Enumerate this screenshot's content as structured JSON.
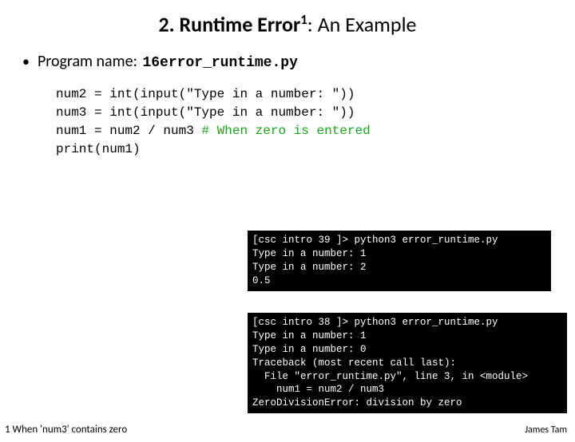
{
  "title": {
    "prefix_number": "2.",
    "bold_text": "Runtime Error",
    "sup": "1",
    "tail": ": An Example"
  },
  "bullet": {
    "label": "Program name:",
    "program": "16error_runtime.py"
  },
  "code": {
    "l1": "num2 = int(input(\"Type in a number: \"))",
    "l2": "num3 = int(input(\"Type in a number: \"))",
    "l3a": "num1 = num2 / num3 ",
    "l3b": "# When zero is entered",
    "l4": "print(num1)"
  },
  "terminal1": "[csc intro 39 ]> python3 error_runtime.py\nType in a number: 1\nType in a number: 2\n0.5",
  "terminal2": "[csc intro 38 ]> python3 error_runtime.py\nType in a number: 1\nType in a number: 0\nTraceback (most recent call last):\n  File \"error_runtime.py\", line 3, in <module>\n    num1 = num2 / num3\nZeroDivisionError: division by zero",
  "footnote_left": "1 When 'num3' contains zero",
  "footnote_right": "James Tam"
}
